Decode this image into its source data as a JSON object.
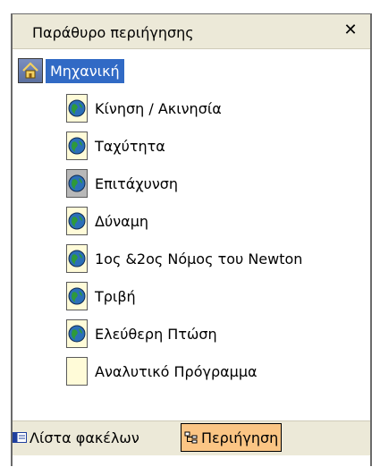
{
  "panel": {
    "title": "Παράθυρο περιήγησης",
    "close_symbol": "✕"
  },
  "tree": {
    "root": {
      "label": "Μηχανική",
      "icon": "home-icon"
    },
    "items": [
      {
        "label": "Κίνηση / Ακινησία",
        "icon": "globe-icon",
        "active": false
      },
      {
        "label": "Ταχύτητα",
        "icon": "globe-icon",
        "active": false
      },
      {
        "label": "Επιτάχυνση",
        "icon": "globe-icon",
        "active": true
      },
      {
        "label": "Δύναμη",
        "icon": "globe-icon",
        "active": false
      },
      {
        "label": "1ος &2ος Νόμος του Newton",
        "icon": "globe-icon",
        "active": false
      },
      {
        "label": "Τριβή",
        "icon": "globe-icon",
        "active": false
      },
      {
        "label": "Ελεύθερη Πτώση",
        "icon": "globe-icon",
        "active": false
      },
      {
        "label": "Αναλυτικό Πρόγραμμα",
        "icon": "blank-page-icon",
        "active": false
      }
    ]
  },
  "tabs": {
    "folders_label": "Λίστα φακέλων",
    "navigation_label": "Περιήγηση",
    "selected": "navigation"
  },
  "colors": {
    "selection": "#316ac5",
    "active_tab": "#fbc584",
    "chrome": "#ece9d8",
    "page": "#fffbd8"
  }
}
